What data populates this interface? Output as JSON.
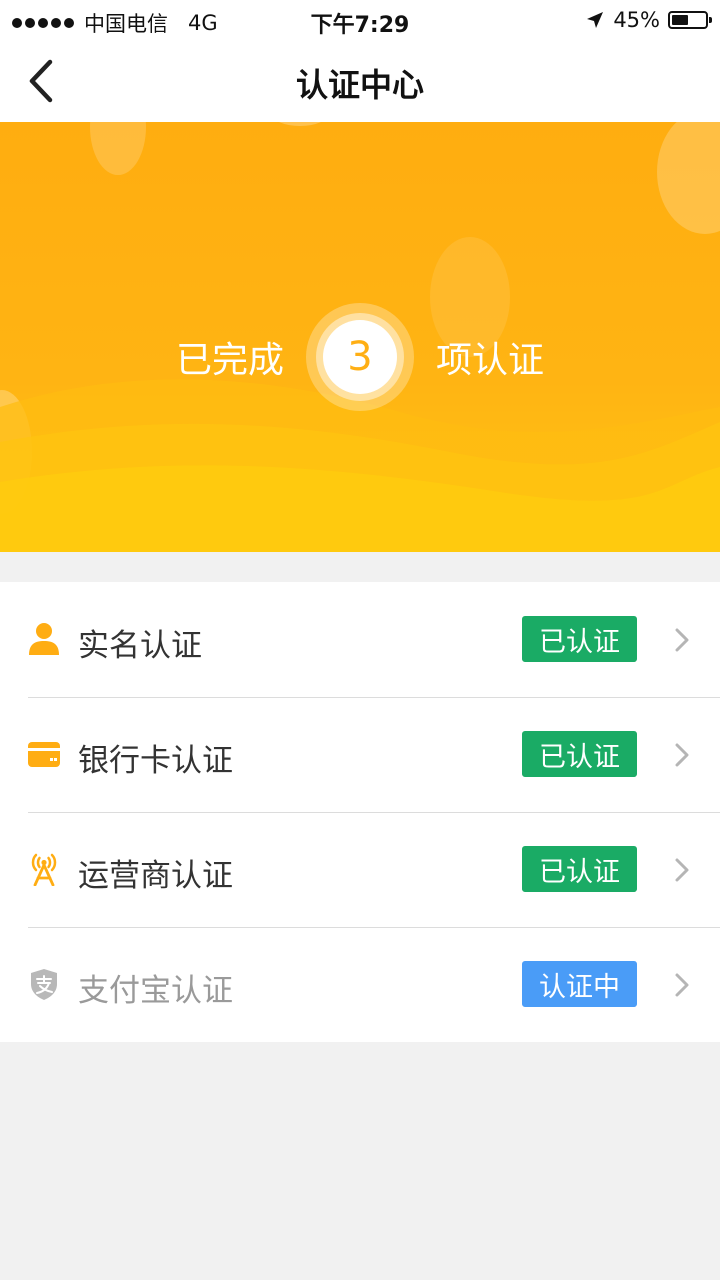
{
  "status_bar": {
    "carrier": "中国电信",
    "network": "4G",
    "time": "下午7:29",
    "battery": "45%"
  },
  "nav": {
    "title": "认证中心",
    "back_icon": "chevron-left-icon"
  },
  "banner": {
    "prefix": "已完成",
    "count": "3",
    "suffix": "项认证",
    "color": "#ffb413"
  },
  "items": [
    {
      "label": "实名认证",
      "status": "已认证",
      "icon": "person-icon",
      "status_color": "#1aab65"
    },
    {
      "label": "银行卡认证",
      "status": "已认证",
      "icon": "card-icon",
      "status_color": "#1aab65"
    },
    {
      "label": "运营商认证",
      "status": "已认证",
      "icon": "signal-tower-icon",
      "status_color": "#1aab65"
    },
    {
      "label": "支付宝认证",
      "status": "认证中",
      "icon": "alipay-shield-icon",
      "status_color": "#4a9cf7"
    }
  ]
}
